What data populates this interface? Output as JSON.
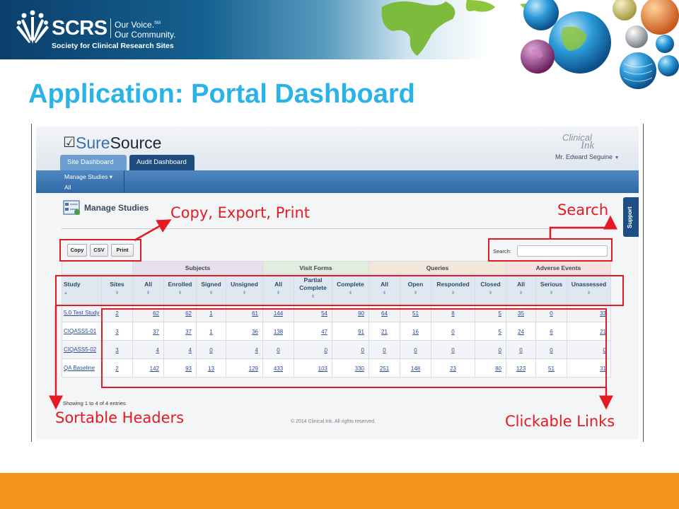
{
  "banner": {
    "logo_word": "SCRS",
    "tagline_1": "Our Voice.",
    "tagline_1_mark": "SM",
    "tagline_2": "Our Community.",
    "subtitle": "Society for Clinical Research Sites"
  },
  "slide_title": "Application: Portal Dashboard",
  "app": {
    "brand_check": "☑",
    "brand_sure": "Sure",
    "brand_source": "Source",
    "clinical_logo": "Clinical",
    "clinical_logo_2": "Ink",
    "user": "Mr. Edward Seguine",
    "tabs": [
      "Site Dashboard",
      "Audit Dashboard"
    ],
    "nav_menu": "Manage Studies ▾",
    "nav_sub": "All",
    "page_title": "Manage Studies",
    "support": "Support",
    "buttons": {
      "copy": "Copy",
      "csv": "CSV",
      "print": "Print"
    },
    "search_label": "Search:",
    "search_value": "",
    "groups": [
      "Subjects",
      "Visit Forms",
      "Queries",
      "Adverse Events"
    ],
    "columns": [
      "Study",
      "Sites",
      "All",
      "Enrolled",
      "Signed",
      "Unsigned",
      "All",
      "Partial Complete",
      "Complete",
      "All",
      "Open",
      "Responded",
      "Closed",
      "All",
      "Serious",
      "Unassessed"
    ],
    "rows": [
      [
        "5.0 Test Study",
        "2",
        "62",
        "62",
        "1",
        "61",
        "144",
        "54",
        "90",
        "64",
        "51",
        "8",
        "5",
        "35",
        "0",
        "33"
      ],
      [
        "CIQASS5-01",
        "3",
        "37",
        "37",
        "1",
        "36",
        "138",
        "47",
        "91",
        "21",
        "16",
        "0",
        "5",
        "24",
        "6",
        "21"
      ],
      [
        "CIQASS5-02",
        "3",
        "4",
        "4",
        "0",
        "4",
        "0",
        "0",
        "0",
        "0",
        "0",
        "0",
        "0",
        "0",
        "0",
        "0"
      ],
      [
        "QA Baseline",
        "2",
        "142",
        "93",
        "13",
        "129",
        "433",
        "103",
        "330",
        "251",
        "148",
        "23",
        "80",
        "123",
        "51",
        "31"
      ]
    ],
    "entries_info": "Showing 1 to 4 of 4 entries",
    "copyright": "© 2014 Clinical Ink. All rights reserved."
  },
  "annotations": {
    "copy_export_print": "Copy, Export, Print",
    "search": "Search",
    "sortable_headers": "Sortable Headers",
    "clickable_links": "Clickable Links"
  },
  "colors": {
    "title_blue": "#29b3e8",
    "annotation_red": "#e31b23",
    "footer_orange": "#f7941d",
    "nav_blue": "#2f6aa8"
  }
}
